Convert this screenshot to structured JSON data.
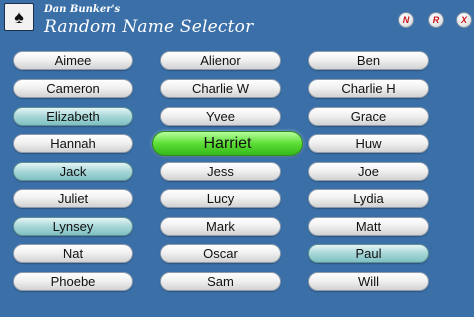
{
  "header": {
    "subtitle": "Dan Bunker's",
    "title": "Random Name Selector",
    "logo_icon": "playing-cards-icon"
  },
  "controls": [
    {
      "label": "N",
      "icon": "new-icon"
    },
    {
      "label": "R",
      "icon": "reset-icon"
    },
    {
      "label": "X",
      "icon": "close-icon"
    }
  ],
  "colors": {
    "background": "#3a6fa8",
    "highlight_teal": "#a8d6d7",
    "selected_green": "#5dde36"
  },
  "columns": [
    [
      {
        "name": "Aimee",
        "state": "normal"
      },
      {
        "name": "Cameron",
        "state": "normal"
      },
      {
        "name": "Elizabeth",
        "state": "highlighted"
      },
      {
        "name": "Hannah",
        "state": "normal"
      },
      {
        "name": "Jack",
        "state": "highlighted"
      },
      {
        "name": "Juliet",
        "state": "normal"
      },
      {
        "name": "Lynsey",
        "state": "highlighted"
      },
      {
        "name": "Nat",
        "state": "normal"
      },
      {
        "name": "Phoebe",
        "state": "normal"
      }
    ],
    [
      {
        "name": "Alienor",
        "state": "normal"
      },
      {
        "name": "Charlie W",
        "state": "normal"
      },
      {
        "name": "Yvee",
        "state": "normal"
      },
      {
        "name": "Harriet",
        "state": "selected"
      },
      {
        "name": "Jess",
        "state": "normal"
      },
      {
        "name": "Lucy",
        "state": "normal"
      },
      {
        "name": "Mark",
        "state": "normal"
      },
      {
        "name": "Oscar",
        "state": "normal"
      },
      {
        "name": "Sam",
        "state": "normal"
      }
    ],
    [
      {
        "name": "Ben",
        "state": "normal"
      },
      {
        "name": "Charlie H",
        "state": "normal"
      },
      {
        "name": "Grace",
        "state": "normal"
      },
      {
        "name": "Huw",
        "state": "normal"
      },
      {
        "name": "Joe",
        "state": "normal"
      },
      {
        "name": "Lydia",
        "state": "normal"
      },
      {
        "name": "Matt",
        "state": "normal"
      },
      {
        "name": "Paul",
        "state": "highlighted"
      },
      {
        "name": "Will",
        "state": "normal"
      }
    ]
  ]
}
